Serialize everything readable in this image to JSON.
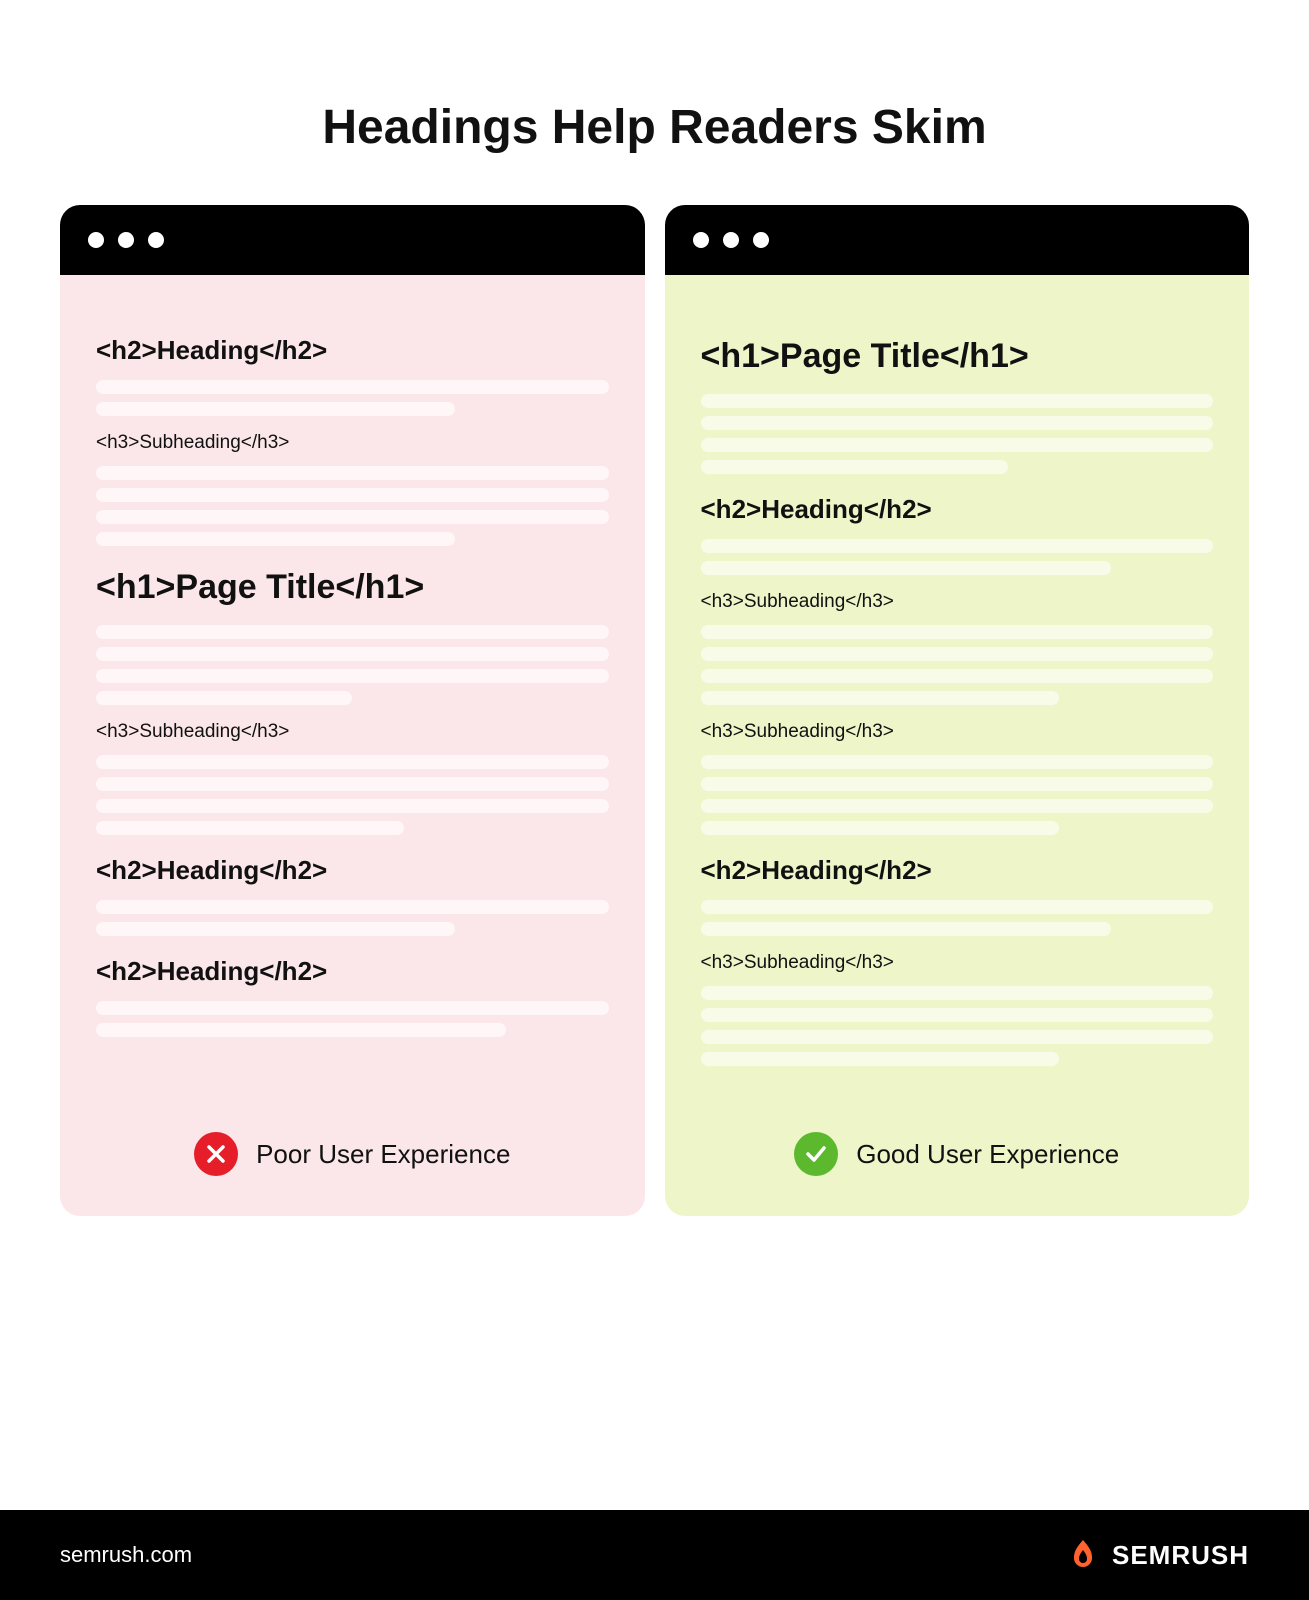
{
  "title": "Headings Help Readers Skim",
  "panels": {
    "poor": {
      "blocks": [
        {
          "kind": "h2",
          "text": "<h2>Heading</h2>"
        },
        {
          "kind": "bars",
          "widths": [
            "w100",
            "w70"
          ]
        },
        {
          "kind": "h3",
          "text": "<h3>Subheading</h3>"
        },
        {
          "kind": "bars",
          "widths": [
            "w100",
            "w100",
            "w100",
            "w70"
          ]
        },
        {
          "kind": "h1",
          "text": "<h1>Page Title</h1>"
        },
        {
          "kind": "bars",
          "widths": [
            "w100",
            "w100",
            "w100",
            "w50"
          ]
        },
        {
          "kind": "h3",
          "text": "<h3>Subheading</h3>"
        },
        {
          "kind": "bars",
          "widths": [
            "w100",
            "w100",
            "w100",
            "w60"
          ]
        },
        {
          "kind": "h2",
          "text": "<h2>Heading</h2>"
        },
        {
          "kind": "bars",
          "widths": [
            "w100",
            "w70"
          ]
        },
        {
          "kind": "h2",
          "text": "<h2>Heading</h2>"
        },
        {
          "kind": "bars",
          "widths": [
            "w100",
            "w80"
          ]
        }
      ],
      "verdict_label": "Poor User Experience"
    },
    "good": {
      "blocks": [
        {
          "kind": "h1",
          "text": "<h1>Page Title</h1>"
        },
        {
          "kind": "bars",
          "widths": [
            "w100",
            "w100",
            "w100",
            "w60"
          ]
        },
        {
          "kind": "h2",
          "text": "<h2>Heading</h2>"
        },
        {
          "kind": "bars",
          "widths": [
            "w100",
            "w80"
          ]
        },
        {
          "kind": "h3",
          "text": "<h3>Subheading</h3>"
        },
        {
          "kind": "bars",
          "widths": [
            "w100",
            "w100",
            "w100",
            "w70"
          ]
        },
        {
          "kind": "h3",
          "text": "<h3>Subheading</h3>"
        },
        {
          "kind": "bars",
          "widths": [
            "w100",
            "w100",
            "w100",
            "w70"
          ]
        },
        {
          "kind": "h2",
          "text": "<h2>Heading</h2>"
        },
        {
          "kind": "bars",
          "widths": [
            "w100",
            "w80"
          ]
        },
        {
          "kind": "h3",
          "text": "<h3>Subheading</h3>"
        },
        {
          "kind": "bars",
          "widths": [
            "w100",
            "w100",
            "w100",
            "w70"
          ]
        }
      ],
      "verdict_label": "Good User Experience"
    }
  },
  "footer": {
    "url": "semrush.com",
    "brand": "SEMRUSH"
  },
  "colors": {
    "poor_bg": "#fbe7e9",
    "good_bg": "#eef5c9",
    "error": "#e61e2a",
    "success": "#5cb82c",
    "brand_accent": "#ff622d"
  }
}
